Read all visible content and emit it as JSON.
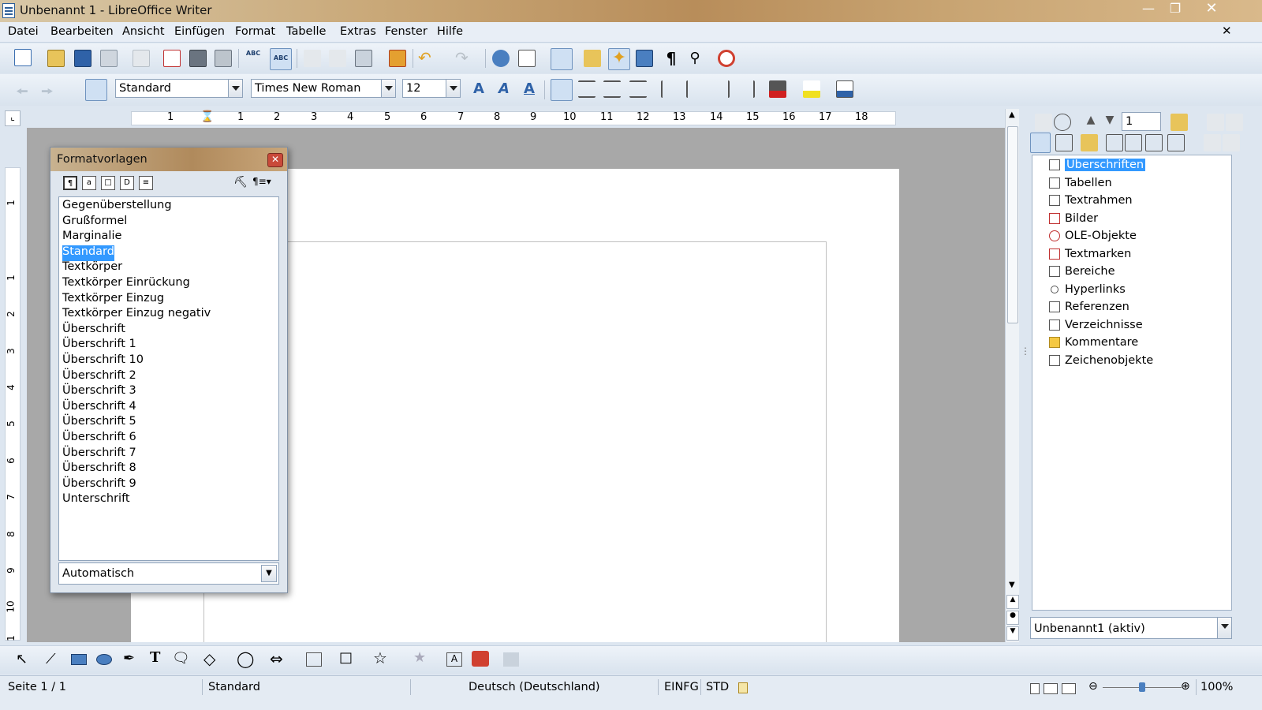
{
  "window": {
    "title": "Unbenannt 1 - LibreOffice Writer"
  },
  "menubar": {
    "items": [
      "Datei",
      "Bearbeiten",
      "Ansicht",
      "Einfügen",
      "Format",
      "Tabelle",
      "Extras",
      "Fenster",
      "Hilfe"
    ]
  },
  "formatting": {
    "paragraph_style": "Standard",
    "font_name": "Times New Roman",
    "font_size": "12"
  },
  "ruler": {
    "h_ticks": [
      "1",
      "1",
      "2",
      "3",
      "4",
      "5",
      "6",
      "7",
      "8",
      "9",
      "10",
      "11",
      "12",
      "13",
      "14",
      "15",
      "16",
      "17",
      "18"
    ],
    "v_ticks": [
      "1",
      "1",
      "2",
      "3",
      "4",
      "5",
      "6",
      "7",
      "8",
      "9",
      "10",
      "1"
    ]
  },
  "styles_dialog": {
    "title": "Formatvorlagen",
    "items": [
      "Gegenüberstellung",
      "Grußformel",
      "Marginalie",
      "Standard",
      "Textkörper",
      "Textkörper Einrückung",
      "Textkörper Einzug",
      "Textkörper Einzug negativ",
      "Überschrift",
      "Überschrift 1",
      "Überschrift 10",
      "Überschrift 2",
      "Überschrift 3",
      "Überschrift 4",
      "Überschrift 5",
      "Überschrift 6",
      "Überschrift 7",
      "Überschrift 8",
      "Überschrift 9",
      "Unterschrift"
    ],
    "selected": "Standard",
    "filter": "Automatisch"
  },
  "navigator": {
    "page_number": "1",
    "items": [
      "Überschriften",
      "Tabellen",
      "Textrahmen",
      "Bilder",
      "OLE-Objekte",
      "Textmarken",
      "Bereiche",
      "Hyperlinks",
      "Referenzen",
      "Verzeichnisse",
      "Kommentare",
      "Zeichenobjekte"
    ],
    "selected": "Überschriften",
    "document": "Unbenannt1 (aktiv)"
  },
  "statusbar": {
    "page": "Seite 1 / 1",
    "style": "Standard",
    "language": "Deutsch (Deutschland)",
    "insert_mode": "EINFG",
    "selection_mode": "STD",
    "zoom": "100%",
    "zoom_level": 1.0
  },
  "colors": {
    "selection": "#3399ff",
    "title_gradient": "#c9a878"
  }
}
